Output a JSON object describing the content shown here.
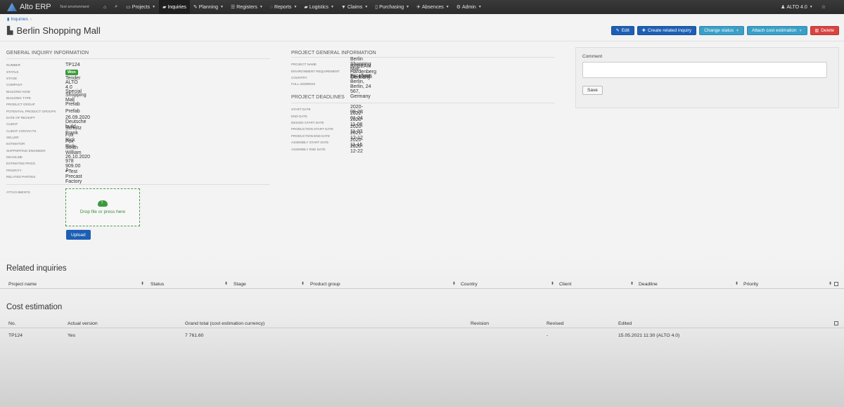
{
  "navbar": {
    "brand": "Alto ERP",
    "environment": "Test environment",
    "items": [
      {
        "label": "",
        "icon": "home-icon",
        "glyph": "⌂"
      },
      {
        "label": "",
        "icon": "search-icon",
        "glyph": "⌕"
      },
      {
        "label": "Projects",
        "icon": "folder-icon",
        "glyph": "▭",
        "dropdown": true
      },
      {
        "label": "Inquiries",
        "icon": "truck-icon",
        "glyph": "▰",
        "active": true
      },
      {
        "label": "Planning",
        "icon": "wrench-icon",
        "glyph": "✎",
        "dropdown": true
      },
      {
        "label": "Registers",
        "icon": "list-icon",
        "glyph": "☰",
        "dropdown": true
      },
      {
        "label": "Reports",
        "icon": "reports-icon",
        "glyph": "◌",
        "dropdown": true
      },
      {
        "label": "Logistics",
        "icon": "logistics-icon",
        "glyph": "▰",
        "dropdown": true
      },
      {
        "label": "Claims",
        "icon": "thumbs-down-icon",
        "glyph": "▼",
        "dropdown": true
      },
      {
        "label": "Purchasing",
        "icon": "document-icon",
        "glyph": "▯",
        "dropdown": true
      },
      {
        "label": "Absences",
        "icon": "plane-icon",
        "glyph": "✈",
        "dropdown": true
      },
      {
        "label": "Admin",
        "icon": "gear-icon",
        "glyph": "⚙",
        "dropdown": true
      }
    ],
    "user": "ALTO 4.0",
    "star": "☆"
  },
  "breadcrumb": {
    "label": "Inquiries"
  },
  "page": {
    "title": "Berlin Shopping Mall"
  },
  "actions": {
    "edit": "Edit",
    "create_related": "Create related inquiry",
    "change_status": "Change status",
    "attach_cost": "Attach cost estimation",
    "delete": "Delete"
  },
  "general": {
    "title": "GENERAL INQUIRY INFORMATION",
    "fields": [
      {
        "key": "NUMBER",
        "value": "TP124"
      },
      {
        "key": "STATUS",
        "value": "Won",
        "badge": true
      },
      {
        "key": "STAGE",
        "value": "Tender"
      },
      {
        "key": "COMPANY",
        "value": "ALTO 4.0"
      },
      {
        "key": "BUILDING KIND",
        "value": "Special"
      },
      {
        "key": "BUILDING TYPE",
        "value": "Shopping Mall"
      },
      {
        "key": "PRODUCT GROUP",
        "value": "Prefab"
      },
      {
        "key": "POTENTIAL PRODUCT GROUPS",
        "value": "Prefab"
      },
      {
        "key": "DATE OF RECEIPT",
        "value": "26.09.2020"
      },
      {
        "key": "CLIENT",
        "value": "Deutsche build",
        "link": true
      },
      {
        "key": "CLIENT CONTACTS",
        "value": "Schultz Frank",
        "link": true
      },
      {
        "key": "SELLER",
        "value": "Fox Rick"
      },
      {
        "key": "ESTIMATOR",
        "value": "Fox Rick"
      },
      {
        "key": "SUPPORTING ENGINEER",
        "value": "Smith William"
      },
      {
        "key": "DEADLINE",
        "value": "26.10.2020"
      },
      {
        "key": "ESTIMATED PRICE",
        "value": "978 909.00"
      },
      {
        "key": "PRIORITY",
        "value": "A"
      },
      {
        "key": "RELATED PARTIES",
        "value": "•   Test Precast Factory"
      }
    ],
    "attachments_label": "ATTACHMENTS",
    "dropzone_text": "Drop file or press here",
    "upload": "Upload"
  },
  "project": {
    "title": "PROJECT GENERAL INFORMATION",
    "fields": [
      {
        "key": "PROJECT NAME",
        "value": "Berlin Shopping Mall",
        "link": true
      },
      {
        "key": "ENVIRONMENT REQUIREMENT",
        "value": "BREEAM - Excellent"
      },
      {
        "key": "COUNTRY",
        "value": "Germany"
      },
      {
        "key": "FULL ADDRESS",
        "value": "Hardenberg 28, 10785 Berlin, Berlin, 24 567, Germany"
      }
    ],
    "deadlines_title": "PROJECT DEADLINES",
    "deadlines": [
      {
        "key": "START DATE",
        "value": "2020-09-28"
      },
      {
        "key": "END DATE",
        "value": "2022-01-24"
      },
      {
        "key": "DESIGN START DATE",
        "value": "2020-11-08"
      },
      {
        "key": "PRODUCTION START DATE",
        "value": "2020-11-23"
      },
      {
        "key": "PRODUCTION END DATE",
        "value": "2021-12-12"
      },
      {
        "key": "ASSEMBLY START DATE",
        "value": "2020-11-15"
      },
      {
        "key": "ASSEMBLY END DATE",
        "value": "2020-12-22"
      }
    ]
  },
  "comment": {
    "label": "Comment",
    "value": "",
    "save": "Save"
  },
  "related": {
    "title": "Related inquiries",
    "columns": [
      "Project name",
      "Status",
      "Stage",
      "Product group",
      "Country",
      "Client",
      "Deadline",
      "Priority"
    ],
    "rows": []
  },
  "cost": {
    "title": "Cost estimation",
    "columns": [
      "No.",
      "Actual version",
      "Grand total (cost estimation currency)",
      "Revision",
      "Revised",
      "Edited"
    ],
    "rows": [
      {
        "no": "TP124",
        "actual": "Yes",
        "total": "7 761.60",
        "revision": "",
        "revised": "-",
        "edited": "15.05.2021 11:30 (ALTO 4.0)"
      }
    ]
  }
}
